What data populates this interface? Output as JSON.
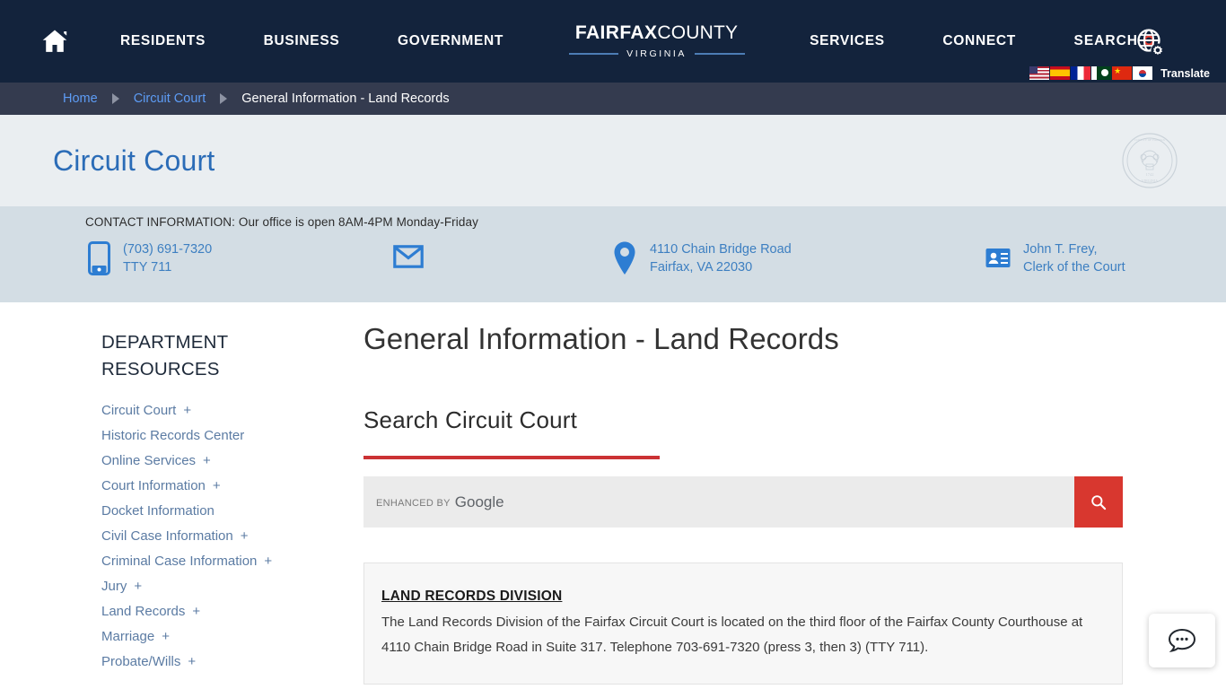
{
  "topnav": {
    "home_icon": "home-icon",
    "links": [
      "RESIDENTS",
      "BUSINESS",
      "GOVERNMENT",
      "SERVICES",
      "CONNECT"
    ],
    "brand_bold": "FAIRFAX",
    "brand_thin": "COUNTY",
    "brand_sub": "VIRGINIA",
    "search_label": "SEARCH",
    "search_icon": "magnifier-icon",
    "globe_icon": "globe-settings-icon",
    "translate_label": "Translate",
    "flags": [
      "us-flag",
      "spain-flag",
      "france-flag",
      "pakistan-flag",
      "china-flag",
      "south-korea-flag"
    ],
    "bg_color": "#13233c"
  },
  "breadcrumb": {
    "items": [
      {
        "label": "Home",
        "current": false
      },
      {
        "label": "Circuit Court",
        "current": false
      },
      {
        "label": "General Information - Land Records",
        "current": true
      }
    ],
    "bg_color": "#343b4f",
    "link_color": "#5d9cf5"
  },
  "title_band": {
    "department": "Circuit Court",
    "seal_icon": "county-seal-watermark",
    "bg_color": "#eaeef1",
    "title_color": "#2b6cb7"
  },
  "contact": {
    "note": "CONTACT INFORMATION: Our office is open 8AM-4PM Monday-Friday",
    "phone_icon": "mobile-phone-icon",
    "phone": "(703) 691-7320",
    "tty": "TTY 711",
    "mail_icon": "envelope-icon",
    "location_icon": "map-pin-icon",
    "address_line1": "4110 Chain Bridge Road",
    "address_line2": "Fairfax, VA 22030",
    "clerk_icon": "id-card-icon",
    "clerk_line1": "John T. Frey,",
    "clerk_line2": "Clerk of the Court",
    "bg_color": "#d3dde4",
    "accent_color": "#2d7dd2"
  },
  "sidebar": {
    "title": "DEPARTMENT RESOURCES",
    "items": [
      {
        "label": "Circuit Court",
        "expandable": "+"
      },
      {
        "label": "Historic Records Center",
        "expandable": ""
      },
      {
        "label": "Online Services",
        "expandable": "+"
      },
      {
        "label": "Court Information",
        "expandable": "+"
      },
      {
        "label": "Docket Information",
        "expandable": ""
      },
      {
        "label": "Civil Case Information",
        "expandable": "+"
      },
      {
        "label": "Criminal Case Information",
        "expandable": "+"
      },
      {
        "label": "Jury",
        "expandable": "+"
      },
      {
        "label": "Land Records",
        "expandable": "+"
      },
      {
        "label": "Marriage",
        "expandable": "+"
      },
      {
        "label": "Probate/Wills",
        "expandable": "+"
      }
    ],
    "link_color": "#5b7ba3"
  },
  "main": {
    "page_title": "General Information - Land Records",
    "section_title": "Search Circuit Court",
    "rule_color": "#cb3234",
    "search": {
      "placeholder_small": "ENHANCED BY",
      "placeholder_brand": "Google",
      "value": "",
      "button_icon": "search-icon",
      "button_color": "#d8372f"
    },
    "card": {
      "title": "LAND RECORDS DIVISION",
      "body": "The Land Records Division of the Fairfax Circuit Court is located on the third floor of the Fairfax County Courthouse at 4110 Chain Bridge Road in Suite 317. Telephone 703-691-7320 (press 3, then 3) (TTY 711)."
    }
  },
  "chat": {
    "icon": "chat-bubble-icon"
  }
}
